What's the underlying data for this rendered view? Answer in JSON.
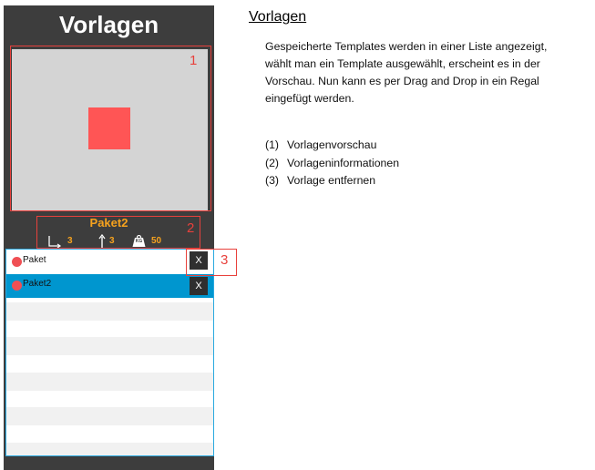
{
  "panel": {
    "title": "Vorlagen",
    "preview": {
      "shape_color": "#ff5555",
      "background": "#d4d4d4"
    },
    "info": {
      "name": "Paket2",
      "width": "3",
      "height": "3",
      "weight_badge": "KG",
      "weight": "50",
      "accent_color": "#f6a21e"
    },
    "list": {
      "items": [
        {
          "label": "Paket",
          "selected": false,
          "remove_label": "X"
        },
        {
          "label": "Paket2",
          "selected": true,
          "remove_label": "X"
        }
      ],
      "selected_color": "#0096cf"
    }
  },
  "annotations": [
    "1",
    "2",
    "3"
  ],
  "doc": {
    "title": "Vorlagen",
    "paragraph_lines": [
      "Gespeicherte Templates werden in einer Liste angezeigt,",
      "wählt man ein Template ausgewählt, erscheint es in der",
      "Vorschau. Nun kann es per Drag and Drop in ein Regal",
      "eingefügt werden."
    ],
    "list": [
      {
        "num": "(1)",
        "text": "Vorlagenvorschau"
      },
      {
        "num": "(2)",
        "text": "Vorlageninformationen"
      },
      {
        "num": "(3)",
        "text": "Vorlage entfernen"
      }
    ]
  }
}
